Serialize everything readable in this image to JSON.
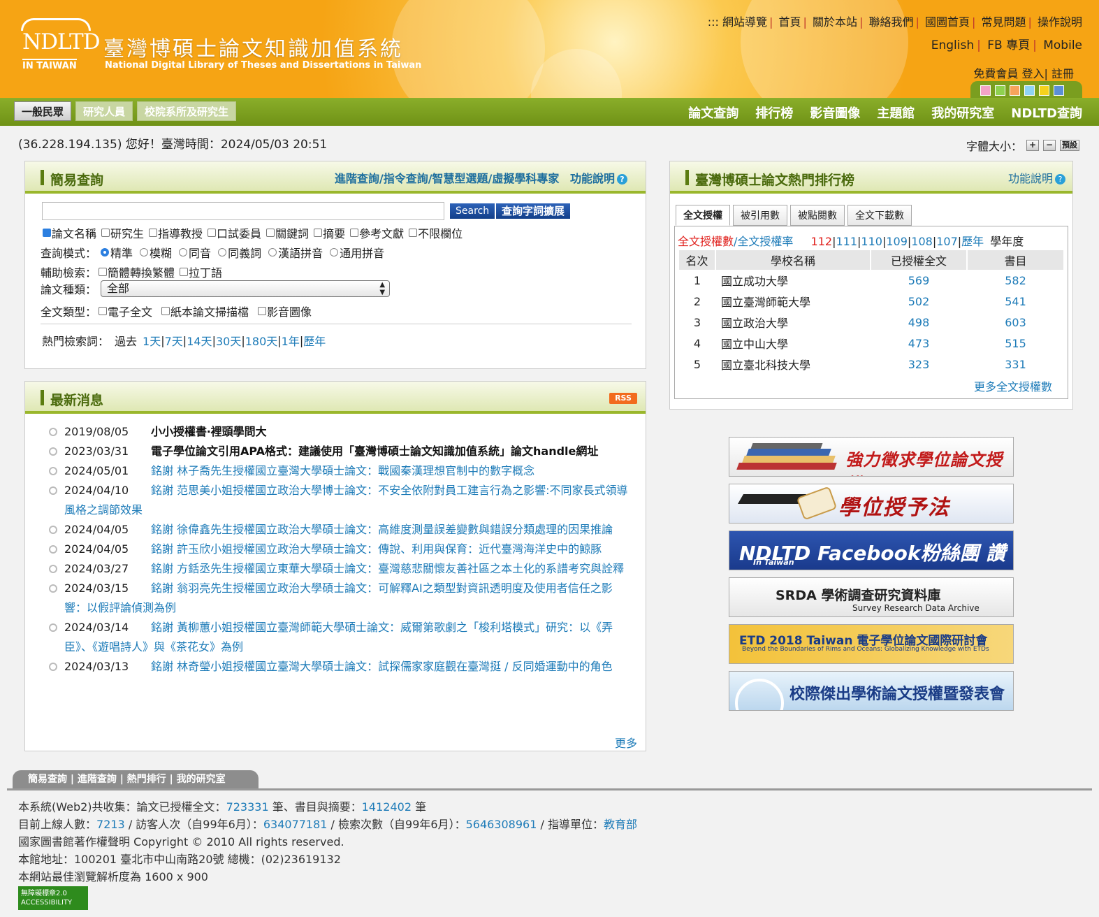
{
  "header": {
    "logo_text": "NDLTD",
    "logo_sub": "IN TAIWAN",
    "title": "臺灣博碩士論文知識加值系統",
    "subtitle": "National Digital Library of Theses and Dissertations in Taiwan",
    "top_prefix": ":::",
    "top_links": [
      "網站導覽",
      "首頁",
      "關於本站",
      "聯絡我們",
      "國圖首頁",
      "常見問題",
      "操作說明"
    ],
    "lang_links": [
      "English",
      "FB 專頁",
      "Mobile"
    ],
    "member_links": [
      "免費會員",
      "登入",
      "註冊"
    ],
    "theme_colors": [
      "#f4a3c6",
      "#8fd14f",
      "#f6a35c",
      "#8fd3f4",
      "#f6d21d",
      "#5b8fd6"
    ]
  },
  "nav": {
    "user_tabs": [
      "一般民眾",
      "研究人員",
      "校院系所及研究生"
    ],
    "main_links": [
      "論文查詢",
      "排行榜",
      "影音圖像",
      "主題館",
      "我的研究室",
      "NDLTD查詢"
    ]
  },
  "status": {
    "text": "(36.228.194.135) 您好！臺灣時間：2024/05/03 20:51",
    "font_size_label": "字體大小：",
    "font_plus": "+",
    "font_minus": "−",
    "font_default": "預設"
  },
  "search": {
    "title": "簡易查詢",
    "links": "進階查詢/指令查詢/智慧型選題/虛擬學科專家",
    "help": "功能說明",
    "query_value": "",
    "search_btn": "Search",
    "expand_btn": "查詢字詞擴展",
    "fields": [
      "論文名稱",
      "研究生",
      "指導教授",
      "口試委員",
      "關鍵詞",
      "摘要",
      "參考文獻",
      "不限欄位"
    ],
    "mode_label": "查詢模式：",
    "modes": [
      "精準",
      "模糊",
      "同音",
      "同義詞",
      "漢語拼音",
      "通用拼音"
    ],
    "aux_label": "輔助檢索：",
    "aux": [
      "簡體轉換繁體",
      "拉丁語"
    ],
    "type_label": "論文種類：",
    "type_value": "全部",
    "fulltext_label": "全文類型：",
    "fulltext": [
      "電子全文",
      "紙本論文掃描檔",
      "影音圖像"
    ],
    "hot_label": "熱門檢索詞：",
    "hot_prefix": "過去",
    "hot_ranges": [
      "1天",
      "7天",
      "14天",
      "30天",
      "180天",
      "1年",
      "歷年"
    ]
  },
  "news": {
    "title": "最新消息",
    "rss": "RSS",
    "more": "更多",
    "items": [
      {
        "date": "2019/08/05",
        "title": "小小授權書‧裡頭學問大",
        "bold": true
      },
      {
        "date": "2023/03/31",
        "title": "電子學位論文引用APA格式：建議使用「臺灣博碩士論文知識加值系統」論文handle網址",
        "bold": true
      },
      {
        "date": "2024/05/01",
        "title": "銘謝 林子喬先生授權國立臺灣大學碩士論文：戰國秦漢理想官制中的數字概念",
        "bold": false
      },
      {
        "date": "2024/04/10",
        "title": "銘謝 范思美小姐授權國立政治大學博士論文：不安全依附對員工建言行為之影響:不同家長式領導風格之調節效果",
        "bold": false
      },
      {
        "date": "2024/04/05",
        "title": "銘謝 徐偉鑫先生授權國立政治大學碩士論文：高維度測量誤差變數與錯誤分類處理的因果推論",
        "bold": false
      },
      {
        "date": "2024/04/05",
        "title": "銘謝 許玉欣小姐授權國立政治大學碩士論文：傳說、利用與保育：近代臺灣海洋史中的鯨豚",
        "bold": false
      },
      {
        "date": "2024/03/27",
        "title": "銘謝 方銛丞先生授權國立東華大學碩士論文：臺灣慈悲關懷友善社區之本土化的系譜考究與詮釋",
        "bold": false
      },
      {
        "date": "2024/03/15",
        "title": "銘謝 翁羽亮先生授權國立政治大學碩士論文：可解釋AI之類型對資訊透明度及使用者信任之影響：以假評論偵測為例",
        "bold": false
      },
      {
        "date": "2024/03/14",
        "title": "銘謝 黃柳蕙小姐授權國立臺灣師範大學碩士論文：威爾第歌劇之「梭利塔模式」研究：以《弄臣》、《遊唱詩人》與《茶花女》為例",
        "bold": false
      },
      {
        "date": "2024/03/13",
        "title": "銘謝 林奇瑩小姐授權國立臺灣大學碩士論文：試探儒家家庭觀在臺灣挺 / 反同婚運動中的角色",
        "bold": false
      }
    ]
  },
  "ranking": {
    "title": "臺灣博碩士論文熱門排行榜",
    "help": "功能說明",
    "tabs": [
      "全文授權",
      "被引用數",
      "被點閱數",
      "全文下載數"
    ],
    "sub_label_red": "全文授權數",
    "sub_label_blue": "/全文授權率",
    "years": [
      "112",
      "111",
      "110",
      "109",
      "108",
      "107",
      "歷年"
    ],
    "year_suffix": "學年度",
    "columns": [
      "名次",
      "學校名稱",
      "已授權全文",
      "書目"
    ],
    "rows": [
      {
        "rank": "1",
        "school": "國立成功大學",
        "authorized": "569",
        "biblio": "582"
      },
      {
        "rank": "2",
        "school": "國立臺灣師範大學",
        "authorized": "502",
        "biblio": "541"
      },
      {
        "rank": "3",
        "school": "國立政治大學",
        "authorized": "498",
        "biblio": "603"
      },
      {
        "rank": "4",
        "school": "國立中山大學",
        "authorized": "473",
        "biblio": "515"
      },
      {
        "rank": "5",
        "school": "國立臺北科技大學",
        "authorized": "323",
        "biblio": "331"
      }
    ],
    "more": "更多全文授權數"
  },
  "banners": [
    {
      "text": "強力徵求學位論文授權",
      "sub": ""
    },
    {
      "text": "學位授予法",
      "sub": ""
    },
    {
      "text": "NDLTD Facebook粉絲團 讚",
      "sub": "In Taiwan"
    },
    {
      "text": "SRDA 學術調查研究資料庫",
      "sub": "Survey Research Data Archive"
    },
    {
      "text": "ETD 2018 Taiwan 電子學位論文國際研討會",
      "sub": "Beyond the Boundaries of Rims and Oceans: Globalizing Knowledge with ETDs"
    },
    {
      "text": "校際傑出學術論文授權暨發表會",
      "sub": ""
    }
  ],
  "footer": {
    "tabs": "簡易查詢 | 進階查詢 | 熱門排行 | 我的研究室",
    "l1_a": "本系統(Web2)共收集：論文已授權全文：",
    "fulltext_count": "723331",
    "l1_b": " 筆、書目與摘要：",
    "biblio_count": "1412402",
    "l1_c": " 筆",
    "l2_a": "目前上線人數：",
    "online": "7213",
    "l2_b": " / 訪客人次（自99年6月）：",
    "visitors": "634077181",
    "l2_c": " / 檢索次數（自99年6月）：",
    "searches": "5646308961",
    "l2_d": " / 指導單位：",
    "agency": "教育部",
    "copyright": "國家圖書館著作權聲明 Copyright © 2010 All rights reserved.",
    "address": "本館地址：100201 臺北市中山南路20號 總機：(02)23619132",
    "resolution": "本網站最佳瀏覽解析度為 1600 x 900",
    "access_badge": "無障礙標章2.0 ACCESSIBILITY"
  }
}
